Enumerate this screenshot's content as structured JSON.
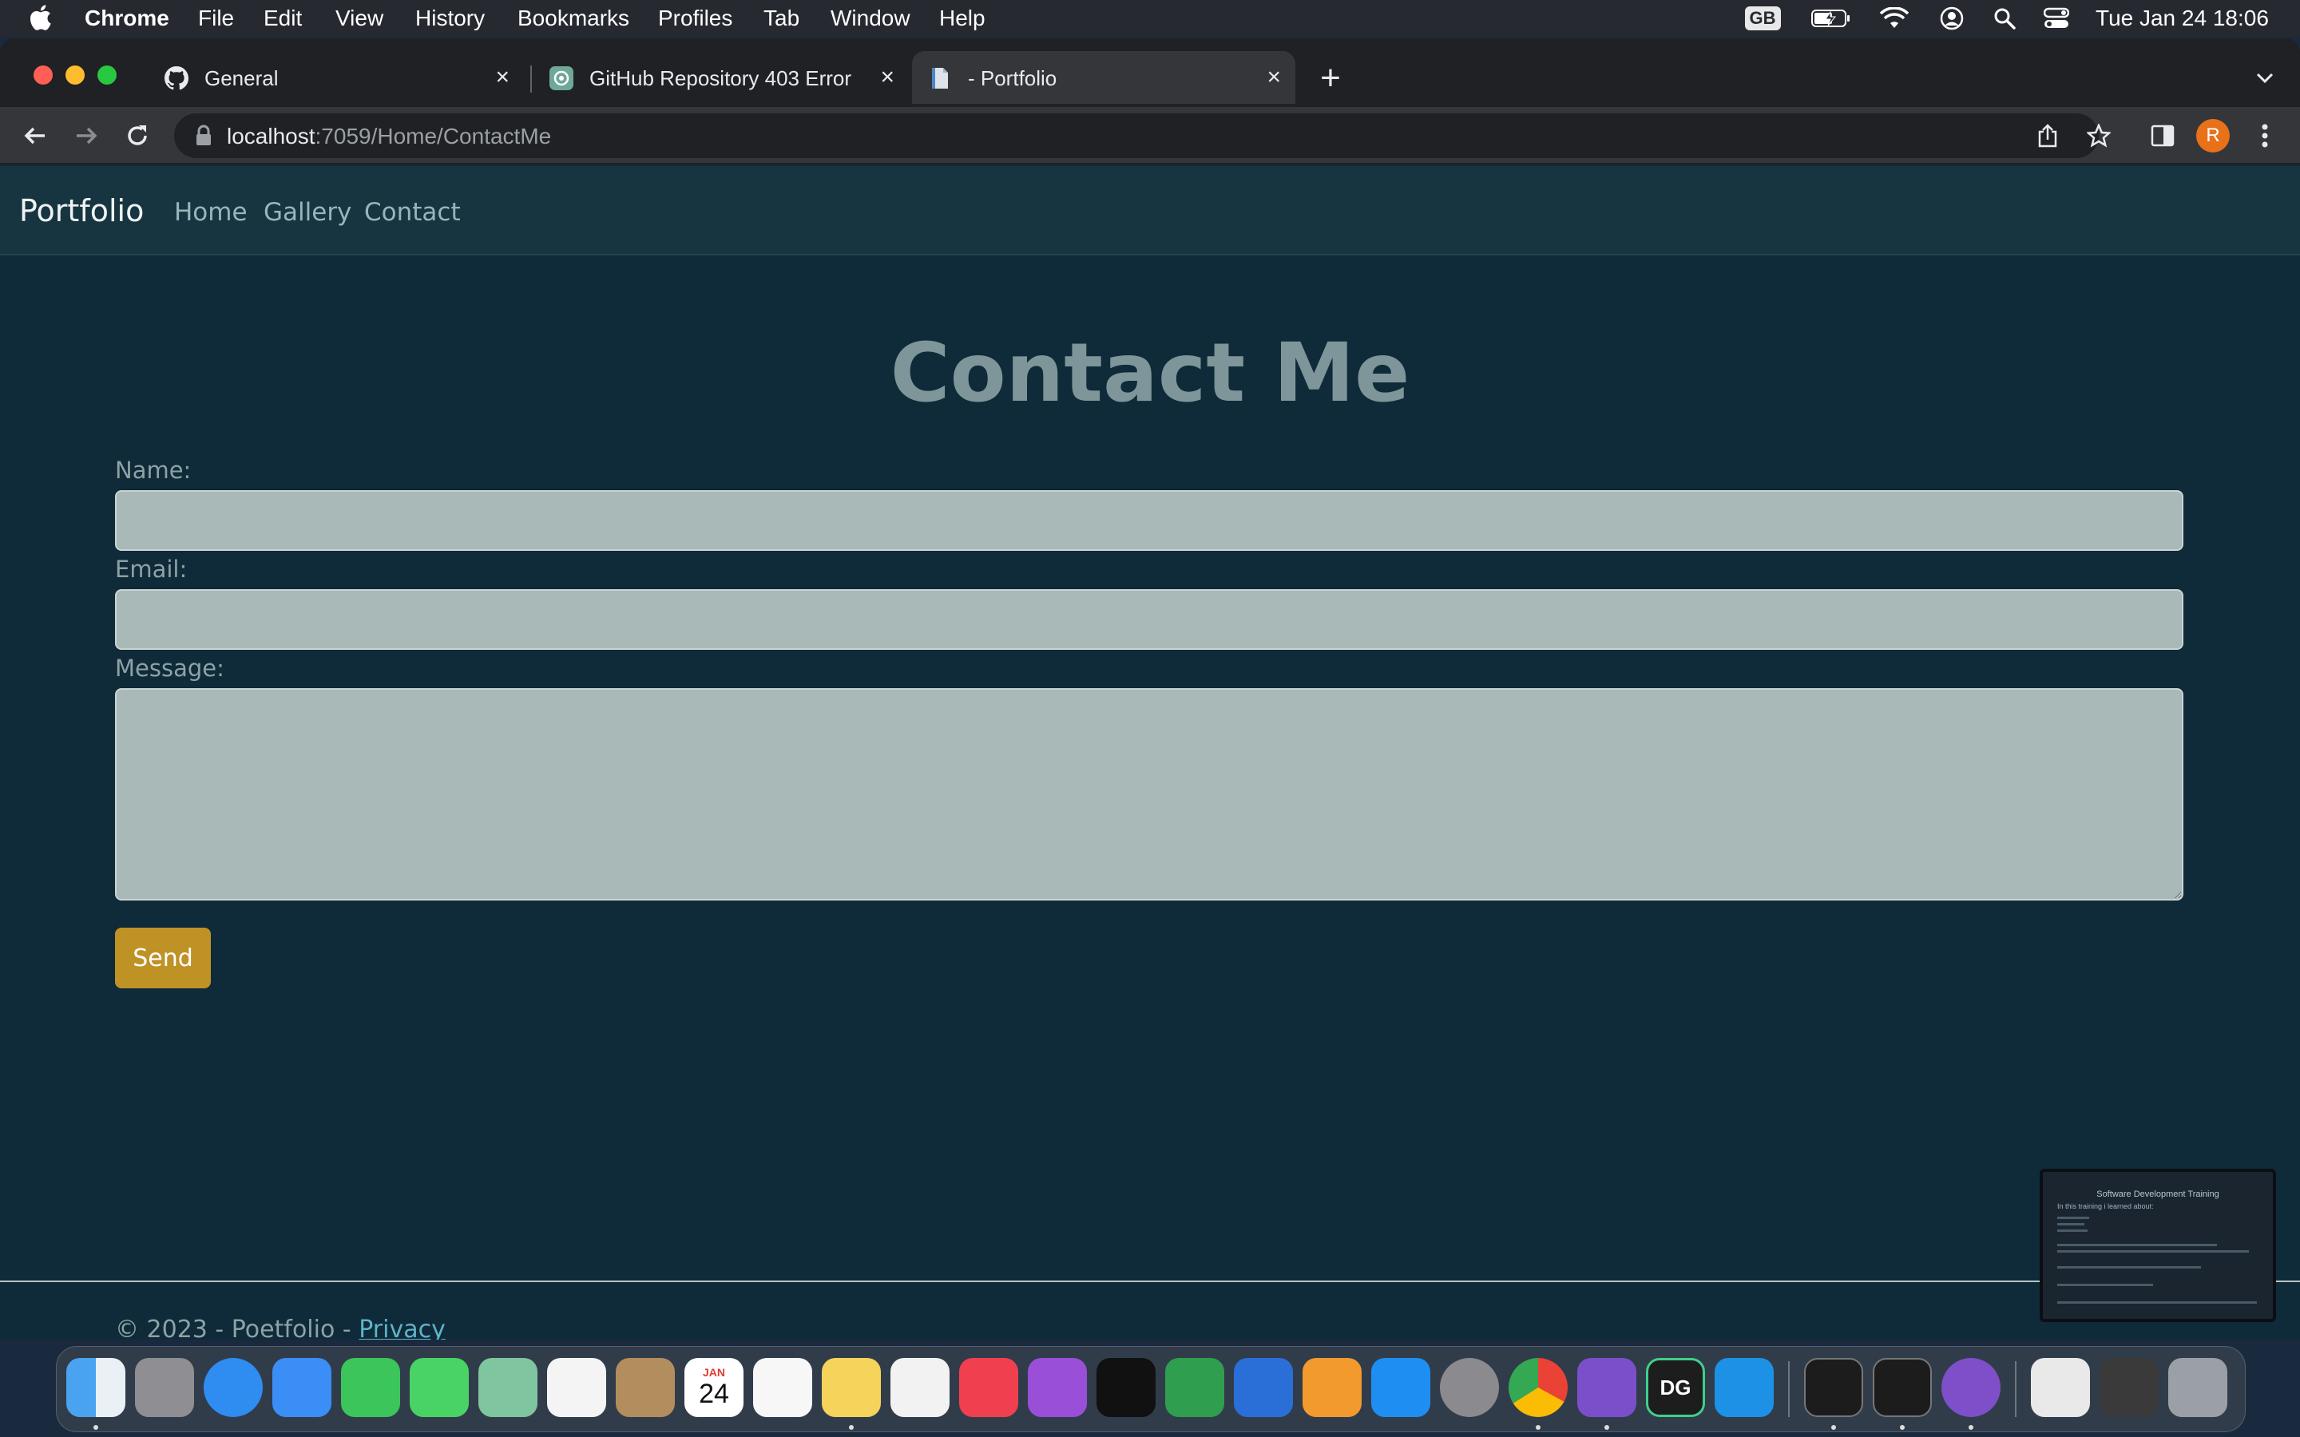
{
  "menubar": {
    "app_name": "Chrome",
    "items": [
      "File",
      "Edit",
      "View",
      "History",
      "Bookmarks",
      "Profiles",
      "Tab",
      "Window",
      "Help"
    ],
    "keyboard_layout": "GB",
    "clock": "Tue Jan 24  18:06"
  },
  "browser": {
    "tabs": [
      {
        "title": "General",
        "icon": "github-icon"
      },
      {
        "title": "GitHub Repository 403 Error",
        "icon": "chatgpt-icon"
      },
      {
        "title": "- Portfolio",
        "icon": "page-icon",
        "active": true
      }
    ],
    "url_host": "localhost",
    "url_path": ":7059/Home/ContactMe",
    "profile_initial": "R"
  },
  "site": {
    "brand": "Portfolio",
    "nav": [
      "Home",
      "Gallery",
      "Contact"
    ],
    "heading": "Contact Me",
    "form": {
      "name_label": "Name:",
      "name_value": "",
      "email_label": "Email:",
      "email_value": "",
      "message_label": "Message:",
      "message_value": "",
      "send_label": "Send"
    },
    "footer": {
      "text": "© 2023 - Poetfolio - ",
      "privacy_link": "Privacy"
    }
  },
  "thumbnail": {
    "title": "Software Development Training",
    "subtitle": "In this training i learned about:"
  },
  "dock": {
    "calendar_month": "JAN",
    "calendar_day": "24",
    "apps": [
      "Finder",
      "Launchpad",
      "Safari",
      "Mail",
      "FaceTime",
      "Messages",
      "Maps",
      "Photos",
      "Contacts",
      "Calendar",
      "Reminders",
      "Notes",
      "Freeform",
      "Music",
      "Podcasts",
      "TV",
      "Numbers",
      "Keynote",
      "Pages",
      "App Store",
      "System Settings",
      "Chrome",
      "Visual Studio",
      "DataGrip",
      "Docker",
      "Terminal",
      "Activity Monitor",
      "GitHub Desktop",
      "Archive",
      "Preview",
      "Trash"
    ]
  },
  "colors": {
    "page_bg": "#0f2a38",
    "navbar_bg": "#173540",
    "input_bg": "#a9b9b8",
    "send_button": "#bf9226",
    "link": "#5fb3c9"
  }
}
